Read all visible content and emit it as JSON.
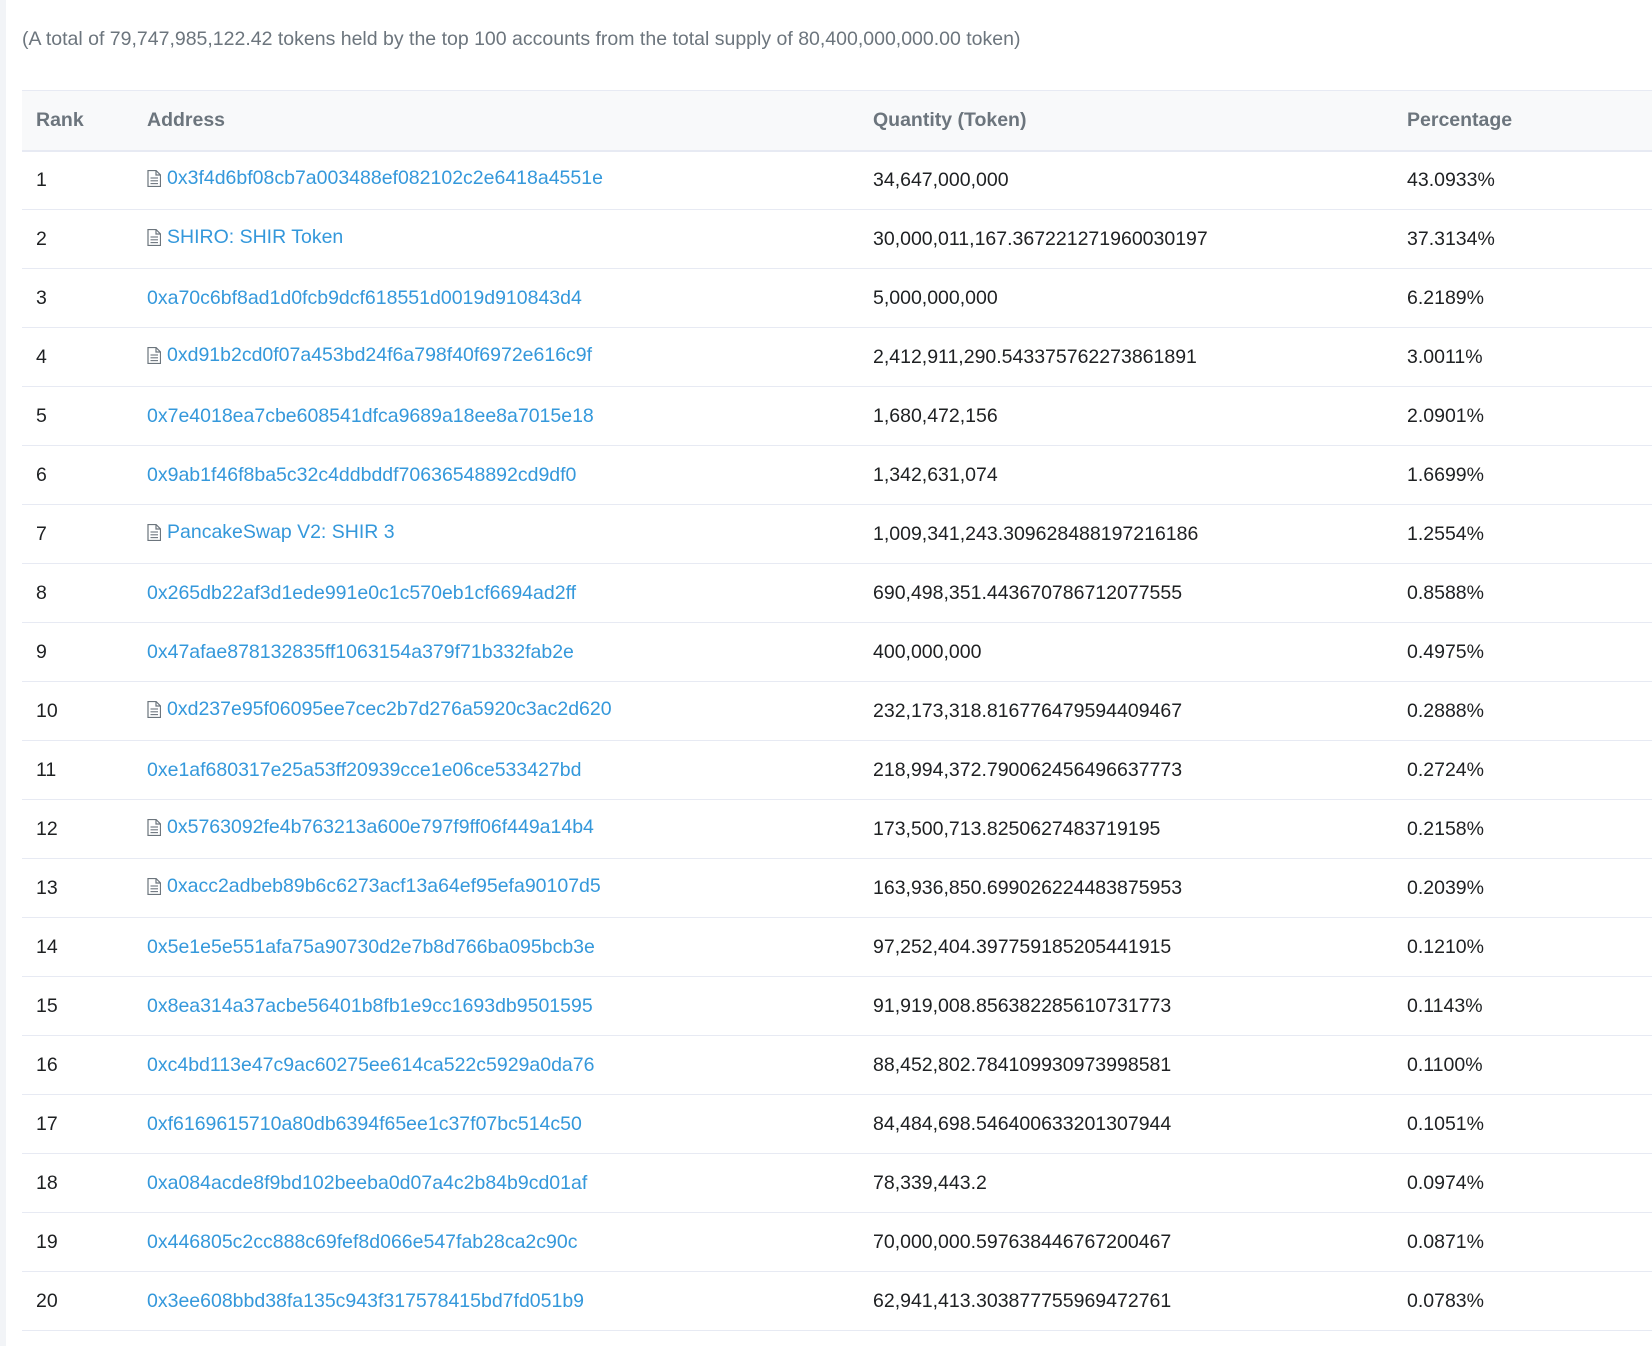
{
  "summary_text": "(A total of 79,747,985,122.42 tokens held by the top 100 accounts from the total supply of 80,400,000,000.00 token)",
  "columns": {
    "rank": "Rank",
    "address": "Address",
    "quantity": "Quantity (Token)",
    "percentage": "Percentage"
  },
  "rows": [
    {
      "rank": "1",
      "address": "0x3f4d6bf08cb7a003488ef082102c2e6418a4551e",
      "contract": true,
      "quantity": "34,647,000,000",
      "percentage": "43.0933%"
    },
    {
      "rank": "2",
      "address": "SHIRO: SHIR Token",
      "contract": true,
      "quantity": "30,000,011,167.367221271960030197",
      "percentage": "37.3134%"
    },
    {
      "rank": "3",
      "address": "0xa70c6bf8ad1d0fcb9dcf618551d0019d910843d4",
      "contract": false,
      "quantity": "5,000,000,000",
      "percentage": "6.2189%"
    },
    {
      "rank": "4",
      "address": "0xd91b2cd0f07a453bd24f6a798f40f6972e616c9f",
      "contract": true,
      "quantity": "2,412,911,290.543375762273861891",
      "percentage": "3.0011%"
    },
    {
      "rank": "5",
      "address": "0x7e4018ea7cbe608541dfca9689a18ee8a7015e18",
      "contract": false,
      "quantity": "1,680,472,156",
      "percentage": "2.0901%"
    },
    {
      "rank": "6",
      "address": "0x9ab1f46f8ba5c32c4ddbddf70636548892cd9df0",
      "contract": false,
      "quantity": "1,342,631,074",
      "percentage": "1.6699%"
    },
    {
      "rank": "7",
      "address": "PancakeSwap V2: SHIR 3",
      "contract": true,
      "quantity": "1,009,341,243.309628488197216186",
      "percentage": "1.2554%"
    },
    {
      "rank": "8",
      "address": "0x265db22af3d1ede991e0c1c570eb1cf6694ad2ff",
      "contract": false,
      "quantity": "690,498,351.443670786712077555",
      "percentage": "0.8588%"
    },
    {
      "rank": "9",
      "address": "0x47afae878132835ff1063154a379f71b332fab2e",
      "contract": false,
      "quantity": "400,000,000",
      "percentage": "0.4975%"
    },
    {
      "rank": "10",
      "address": "0xd237e95f06095ee7cec2b7d276a5920c3ac2d620",
      "contract": true,
      "quantity": "232,173,318.816776479594409467",
      "percentage": "0.2888%"
    },
    {
      "rank": "11",
      "address": "0xe1af680317e25a53ff20939cce1e06ce533427bd",
      "contract": false,
      "quantity": "218,994,372.790062456496637773",
      "percentage": "0.2724%"
    },
    {
      "rank": "12",
      "address": "0x5763092fe4b763213a600e797f9ff06f449a14b4",
      "contract": true,
      "quantity": "173,500,713.8250627483719195",
      "percentage": "0.2158%"
    },
    {
      "rank": "13",
      "address": "0xacc2adbeb89b6c6273acf13a64ef95efa90107d5",
      "contract": true,
      "quantity": "163,936,850.699026224483875953",
      "percentage": "0.2039%"
    },
    {
      "rank": "14",
      "address": "0x5e1e5e551afa75a90730d2e7b8d766ba095bcb3e",
      "contract": false,
      "quantity": "97,252,404.397759185205441915",
      "percentage": "0.1210%"
    },
    {
      "rank": "15",
      "address": "0x8ea314a37acbe56401b8fb1e9cc1693db9501595",
      "contract": false,
      "quantity": "91,919,008.856382285610731773",
      "percentage": "0.1143%"
    },
    {
      "rank": "16",
      "address": "0xc4bd113e47c9ac60275ee614ca522c5929a0da76",
      "contract": false,
      "quantity": "88,452,802.784109930973998581",
      "percentage": "0.1100%"
    },
    {
      "rank": "17",
      "address": "0xf6169615710a80db6394f65ee1c37f07bc514c50",
      "contract": false,
      "quantity": "84,484,698.546400633201307944",
      "percentage": "0.1051%"
    },
    {
      "rank": "18",
      "address": "0xa084acde8f9bd102beeba0d07a4c2b84b9cd01af",
      "contract": false,
      "quantity": "78,339,443.2",
      "percentage": "0.0974%"
    },
    {
      "rank": "19",
      "address": "0x446805c2cc888c69fef8d066e547fab28ca2c90c",
      "contract": false,
      "quantity": "70,000,000.597638446767200467",
      "percentage": "0.0871%"
    },
    {
      "rank": "20",
      "address": "0x3ee608bbd38fa135c943f317578415bd7fd051b9",
      "contract": false,
      "quantity": "62,941,413.303877755969472761",
      "percentage": "0.0783%"
    }
  ],
  "icons": {
    "contract": "contract-icon"
  },
  "colors": {
    "link": "#3498db",
    "header_bg": "#f8f9fa",
    "muted_text": "#6c757d",
    "border": "#e7eaf3"
  }
}
